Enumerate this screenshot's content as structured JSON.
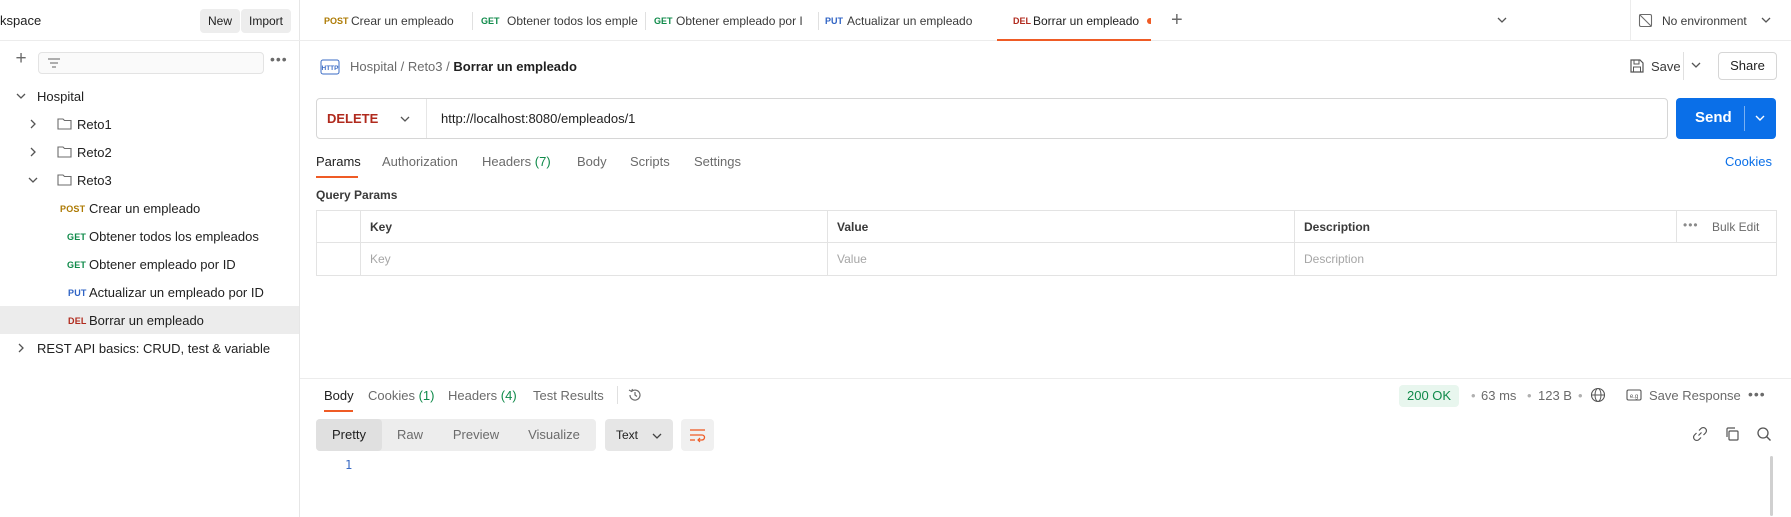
{
  "workspace": {
    "name": "kspace",
    "new_label": "New",
    "import_label": "Import"
  },
  "sidebar": {
    "collection": "Hospital",
    "folders": [
      {
        "label": "Reto1"
      },
      {
        "label": "Reto2"
      },
      {
        "label": "Reto3"
      }
    ],
    "requests": [
      {
        "method": "POST",
        "label": "Crear un empleado"
      },
      {
        "method": "GET",
        "label": "Obtener todos los empleados"
      },
      {
        "method": "GET",
        "label": "Obtener empleado por ID"
      },
      {
        "method": "PUT",
        "label": "Actualizar un empleado por ID"
      },
      {
        "method": "DEL",
        "label": "Borrar un empleado"
      }
    ],
    "other_collection": "REST API basics: CRUD, test & variable"
  },
  "tabs": [
    {
      "method": "POST",
      "label": "Crear un empleado"
    },
    {
      "method": "GET",
      "label": "Obtener todos los emple"
    },
    {
      "method": "GET",
      "label": "Obtener empleado por I"
    },
    {
      "method": "PUT",
      "label": "Actualizar un empleado"
    },
    {
      "method": "DEL",
      "label": "Borrar un empleado"
    }
  ],
  "environment": {
    "label": "No environment"
  },
  "request": {
    "breadcrumb": [
      "Hospital",
      "Reto3",
      "Borrar un empleado"
    ],
    "save_label": "Save",
    "share_label": "Share",
    "method": "DELETE",
    "url": "http://localhost:8080/empleados/1",
    "send_label": "Send",
    "tabs": {
      "params": "Params",
      "authorization": "Authorization",
      "headers": "Headers",
      "headers_count": "(7)",
      "body": "Body",
      "scripts": "Scripts",
      "settings": "Settings"
    },
    "cookies_label": "Cookies",
    "query_params_title": "Query Params",
    "table": {
      "headers": [
        "Key",
        "Value",
        "Description"
      ],
      "placeholders": [
        "Key",
        "Value",
        "Description"
      ],
      "bulk_edit": "Bulk Edit"
    }
  },
  "response": {
    "tabs": {
      "body": "Body",
      "cookies": "Cookies",
      "cookies_count": "(1)",
      "headers": "Headers",
      "headers_count": "(4)",
      "test_results": "Test Results"
    },
    "status": "200 OK",
    "time": "63 ms",
    "size": "123 B",
    "save_response": "Save Response",
    "formats": [
      "Pretty",
      "Raw",
      "Preview",
      "Visualize"
    ],
    "language": "Text",
    "line_number": "1"
  },
  "colors": {
    "accent": "#ef5b25",
    "send": "#0a6fe8",
    "post": "#ad7a03",
    "get": "#0f8a4a",
    "put": "#2f63c4",
    "delete": "#b02a1d"
  }
}
